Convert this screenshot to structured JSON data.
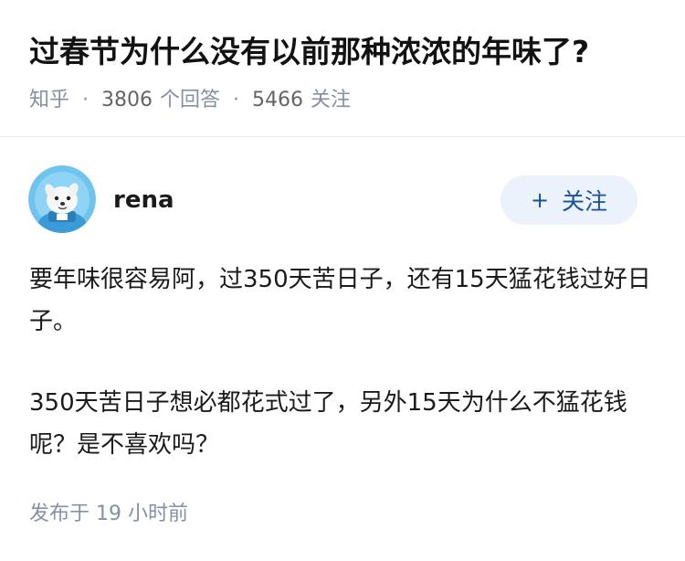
{
  "question": {
    "title": "过春节为什么没有以前那种浓浓的年味了?",
    "source": "知乎",
    "answer_count": "3806",
    "answer_count_unit": "个回答",
    "follower_count": "5466",
    "follower_unit": "关注"
  },
  "author": {
    "name": "rena",
    "avatar_icon": "avatar-dog-icon"
  },
  "follow_button": {
    "icon": "plus-icon",
    "plus": "+",
    "label": "关注"
  },
  "answer": {
    "paragraphs": [
      "要年味很容易阿，过350天苦日子，还有15天猛花钱过好日子。",
      "350天苦日子想必都花式过了，另外15天为什么不猛花钱呢？是不喜欢吗？"
    ],
    "publish_prefix": "发布于",
    "publish_time": "19 小时前"
  },
  "colors": {
    "title": "#121212",
    "meta": "#8590a6",
    "meta_number": "#646464",
    "follow_bg": "#ebf2fb",
    "follow_text": "#175199",
    "divider": "#ebebeb",
    "avatar_bg": "#6fc3ef"
  }
}
